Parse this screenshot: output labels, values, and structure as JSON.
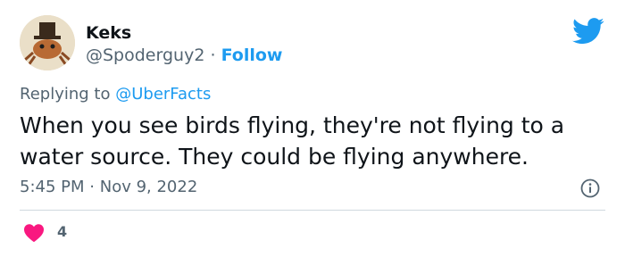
{
  "author": {
    "name": "Keks",
    "handle": "@Spoderguy2",
    "separator": "·",
    "follow_label": "Follow"
  },
  "reply": {
    "prefix": "Replying to",
    "mention": "@UberFacts"
  },
  "tweet": {
    "text": "When you see birds flying, they're not flying to a water source. They could be flying anywhere."
  },
  "meta": {
    "time": "5:45 PM",
    "separator": "·",
    "date": "Nov 9, 2022"
  },
  "engagement": {
    "likes": "4"
  },
  "icons": {
    "logo": "twitter-bird-icon",
    "info": "info-icon",
    "like": "heart-icon"
  },
  "colors": {
    "accent": "#1d9bf0",
    "like": "#f91880",
    "muted": "#536471",
    "text": "#0f1419"
  }
}
